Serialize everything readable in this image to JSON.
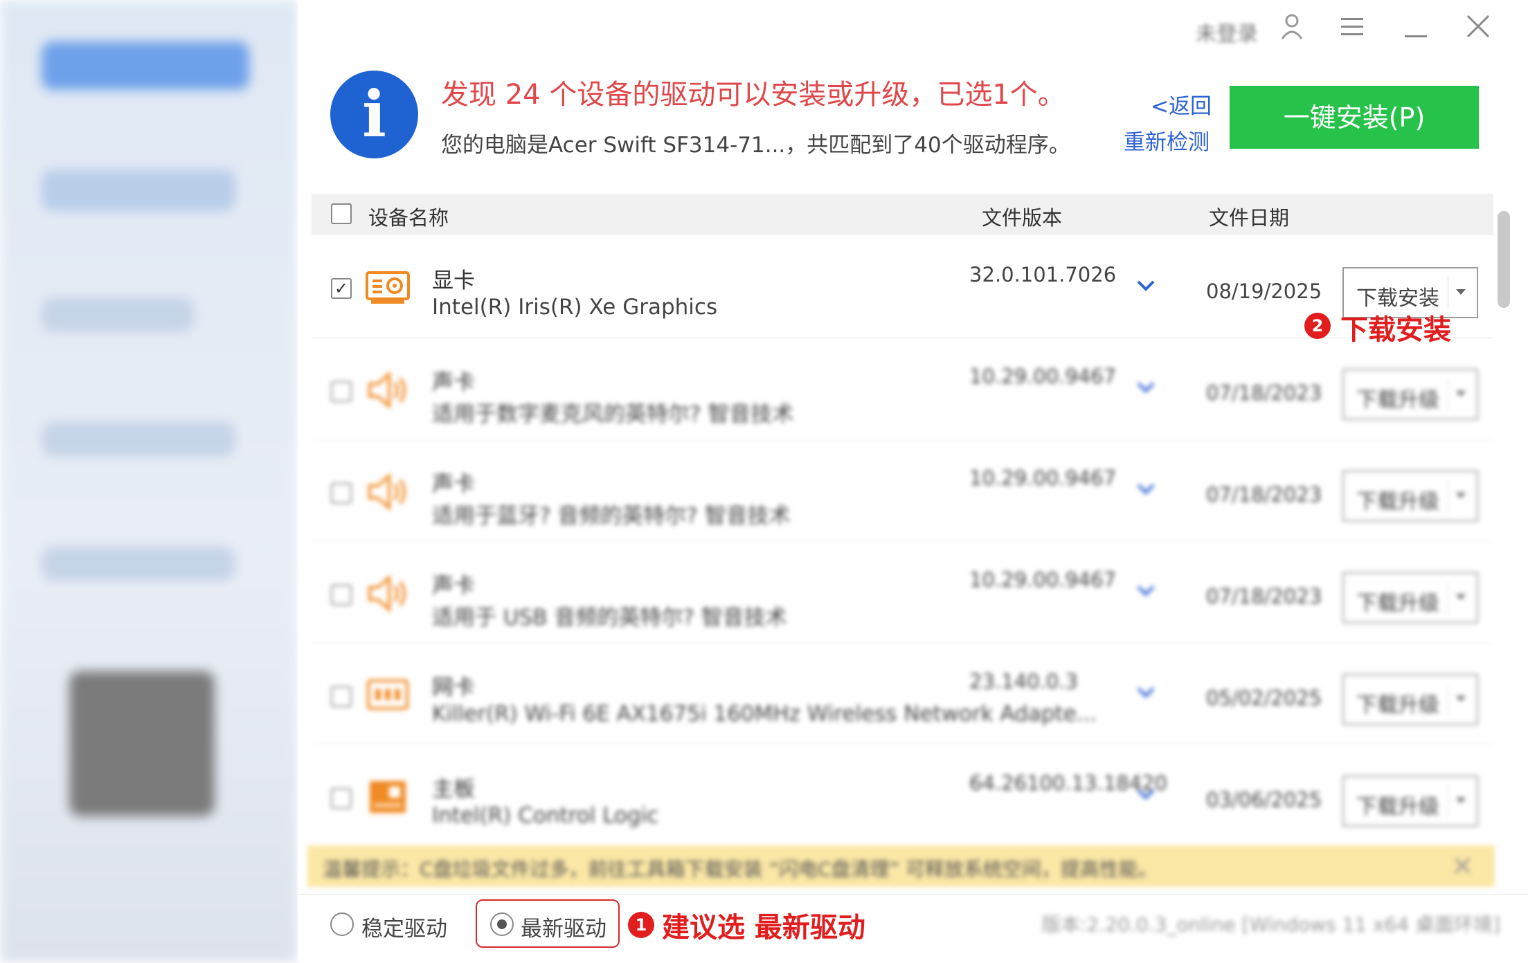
{
  "topbar": {
    "login_label": "未登录"
  },
  "header": {
    "title": "发现 24 个设备的驱动可以安装或升级，已选1个。",
    "subtitle": "您的电脑是Acer Swift SF314-71...，共匹配到了40个驱动程序。",
    "back_link": "<返回",
    "rescan_link": "重新检测",
    "install_button": "一键安装(P)",
    "info_glyph": "i"
  },
  "table": {
    "headers": {
      "name": "设备名称",
      "version": "文件版本",
      "date": "文件日期"
    },
    "rows": [
      {
        "checked": true,
        "icon": "graphics-card-icon",
        "name": "显卡",
        "desc": "Intel(R) Iris(R) Xe Graphics",
        "version": "32.0.101.7026",
        "date": "08/19/2025",
        "action": "下载安装"
      },
      {
        "checked": false,
        "icon": "speaker-icon",
        "name": "声卡",
        "desc": "适用于数字麦克风的英特尔? 智音技术",
        "version": "10.29.00.9467",
        "date": "07/18/2023",
        "action": "下载升级"
      },
      {
        "checked": false,
        "icon": "speaker-icon",
        "name": "声卡",
        "desc": "适用于蓝牙? 音频的英特尔? 智音技术",
        "version": "10.29.00.9467",
        "date": "07/18/2023",
        "action": "下载升级"
      },
      {
        "checked": false,
        "icon": "speaker-icon",
        "name": "声卡",
        "desc": "适用于 USB 音频的英特尔? 智音技术",
        "version": "10.29.00.9467",
        "date": "07/18/2023",
        "action": "下载升级"
      },
      {
        "checked": false,
        "icon": "network-card-icon",
        "name": "网卡",
        "desc": "Killer(R) Wi-Fi 6E AX1675i 160MHz Wireless Network Adapte...",
        "version": "23.140.0.3",
        "date": "05/02/2025",
        "action": "下载升级"
      },
      {
        "checked": false,
        "icon": "motherboard-icon",
        "name": "主板",
        "desc": "Intel(R) Control Logic",
        "version": "64.26100.13.18420",
        "date": "03/06/2025",
        "action": "下载升级"
      }
    ]
  },
  "tip": {
    "text": "温馨提示：C盘垃圾文件过多，前往工具箱下载安装 “闪电C盘清理” 可释放系统空间，提高性能。"
  },
  "footer": {
    "stable_label": "稳定驱动",
    "latest_label": "最新驱动",
    "selected": "latest",
    "version_text": "版本:2.20.0.3_online [Windows 11 x64 桌面环境]"
  },
  "annotations": {
    "step1_number": "1",
    "step1_text": "建议选 最新驱动",
    "step2_number": "2",
    "step2_text": "下载安装"
  },
  "colors": {
    "accent_green": "#26c24a",
    "title_red": "#e0474a",
    "link_blue": "#2d62d2",
    "info_blue": "#1f63d2",
    "annotation_red": "#e11d1d",
    "device_orange": "#f08a24"
  }
}
